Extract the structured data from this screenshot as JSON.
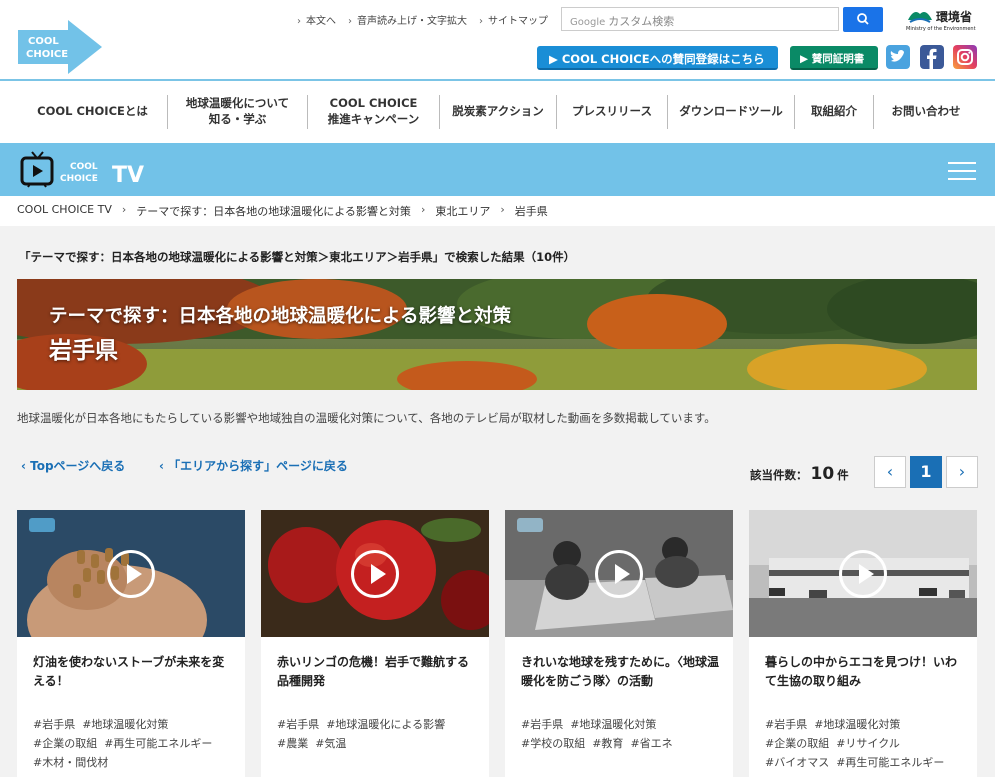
{
  "header": {
    "util_links": [
      "本文へ",
      "音声読み上げ・文字拡大",
      "サイトマップ"
    ],
    "search_placeholder": "カスタム検索",
    "search_brand": "Google",
    "ministry": "環境省",
    "ministry_en": "Ministry of the Environment",
    "register_button": "COOL CHOICEへの賛同登録はこちら",
    "certificate_button": "賛同証明書",
    "logo_text": "COOL CHOICE"
  },
  "nav": [
    "COOL CHOICEとは",
    "地球温暖化について\n知る・学ぶ",
    "COOL CHOICE\n推進キャンペーン",
    "脱炭素アクション",
    "プレスリリース",
    "ダウンロードツール",
    "取組紹介",
    "お問い合わせ"
  ],
  "tv_logo": {
    "line1": "COOL",
    "line2": "CHOICE",
    "tv": "TV"
  },
  "breadcrumb": [
    "COOL CHOICE TV",
    "テーマで探す：日本各地の地球温暖化による影響と対策",
    "東北エリア",
    "岩手県"
  ],
  "result_text": "「テーマで探す：日本各地の地球温暖化による影響と対策＞東北エリア＞岩手県」で検索した結果（10件）",
  "hero": {
    "title": "テーマで探す：日本各地の地球温暖化による影響と対策",
    "subtitle": "岩手県"
  },
  "description": "地球温暖化が日本各地にもたらしている影響や地域独自の温暖化対策について、各地のテレビ局が取材した動画を多数掲載しています。",
  "back_top": "Topページへ戻る",
  "back_area": "「エリアから探す」ページに戻る",
  "count": {
    "prefix": "該当件数：",
    "value": "10",
    "suffix": "件"
  },
  "pagination": {
    "prev": "‹",
    "current": "1",
    "next": "›"
  },
  "cards": [
    {
      "title": "灯油を使わないストーブが未来を変える！",
      "tags": [
        "#岩手県",
        "#地球温暖化対策",
        "#企業の取組",
        "#再生可能エネルギー",
        "#木材・間伐材"
      ]
    },
    {
      "title": "赤いリンゴの危機！岩手で難航する品種開発",
      "tags": [
        "#岩手県",
        "#地球温暖化による影響",
        "#農業",
        "#気温"
      ]
    },
    {
      "title": "きれいな地球を残すために。〈地球温暖化を防ごう隊〉の活動",
      "tags": [
        "#岩手県",
        "#地球温暖化対策",
        "#学校の取組",
        "#教育",
        "#省エネ"
      ]
    },
    {
      "title": "暮らしの中からエコを見つけ！いわて生協の取り組み",
      "tags": [
        "#岩手県",
        "#地球温暖化対策",
        "#企業の取組",
        "#リサイクル",
        "#バイオマス",
        "#再生可能エネルギー"
      ]
    }
  ],
  "colors": {
    "accent": "#72c2e8",
    "link": "#1a6fb5",
    "register": "#1a8ed6",
    "certificate": "#0a8a66"
  }
}
